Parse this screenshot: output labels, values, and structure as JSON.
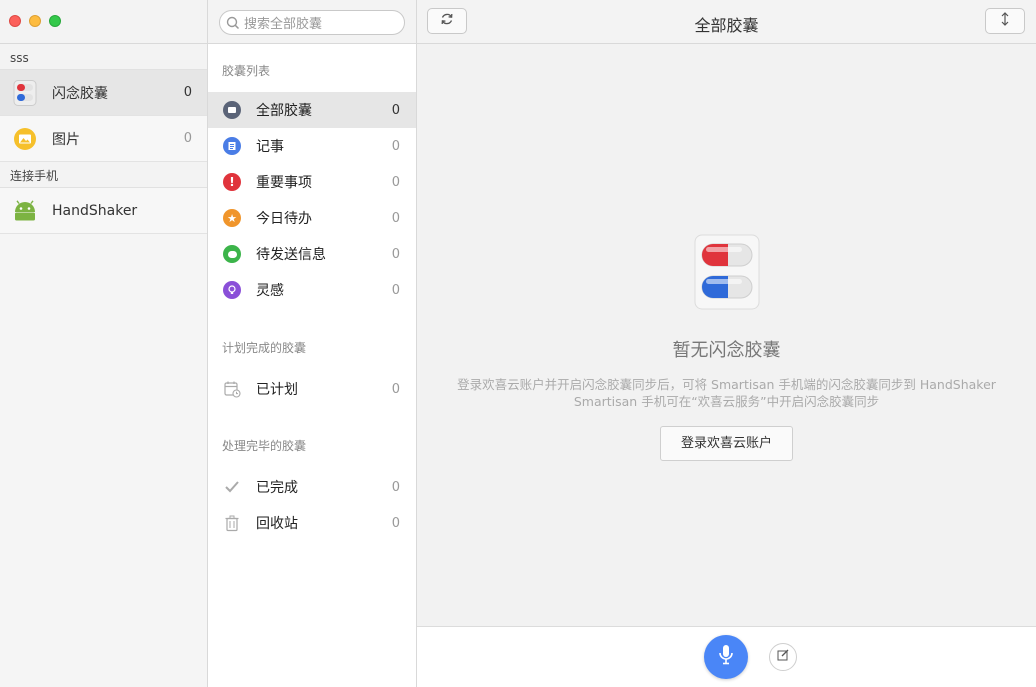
{
  "sidebar": {
    "account_label": "sss",
    "items": [
      {
        "label": "闪念胶囊",
        "count": "0"
      },
      {
        "label": "图片",
        "count": "0"
      }
    ],
    "phone_label": "连接手机",
    "phone_item": {
      "label": "HandShaker"
    }
  },
  "search": {
    "placeholder": "搜索全部胶囊"
  },
  "list": {
    "section1": "胶囊列表",
    "items": [
      {
        "label": "全部胶囊",
        "count": "0"
      },
      {
        "label": "记事",
        "count": "0"
      },
      {
        "label": "重要事项",
        "count": "0"
      },
      {
        "label": "今日待办",
        "count": "0"
      },
      {
        "label": "待发送信息",
        "count": "0"
      },
      {
        "label": "灵感",
        "count": "0"
      }
    ],
    "section2": "计划完成的胶囊",
    "planned": {
      "label": "已计划",
      "count": "0"
    },
    "section3": "处理完毕的胶囊",
    "done": {
      "label": "已完成",
      "count": "0"
    },
    "trash": {
      "label": "回收站",
      "count": "0"
    }
  },
  "main": {
    "title": "全部胶囊",
    "empty_title": "暂无闪念胶囊",
    "empty_desc_line1": "登录欢喜云账户并开启闪念胶囊同步后，可将 Smartisan 手机端的闪念胶囊同步到 HandShaker",
    "empty_desc_line2": "Smartisan 手机可在“欢喜云服务”中开启闪念胶囊同步",
    "login_button": "登录欢喜云账户"
  },
  "colors": {
    "accent_blue": "#4a86f7",
    "red": "#fc605b",
    "yellow": "#fdbc40",
    "green": "#34c84a"
  },
  "icons": [
    "capsule-icon",
    "picture-icon",
    "android-icon",
    "search-icon",
    "sync-icon",
    "sort-icon",
    "mic-icon",
    "edit-icon",
    "check-icon",
    "trash-icon",
    "calendar-icon"
  ]
}
